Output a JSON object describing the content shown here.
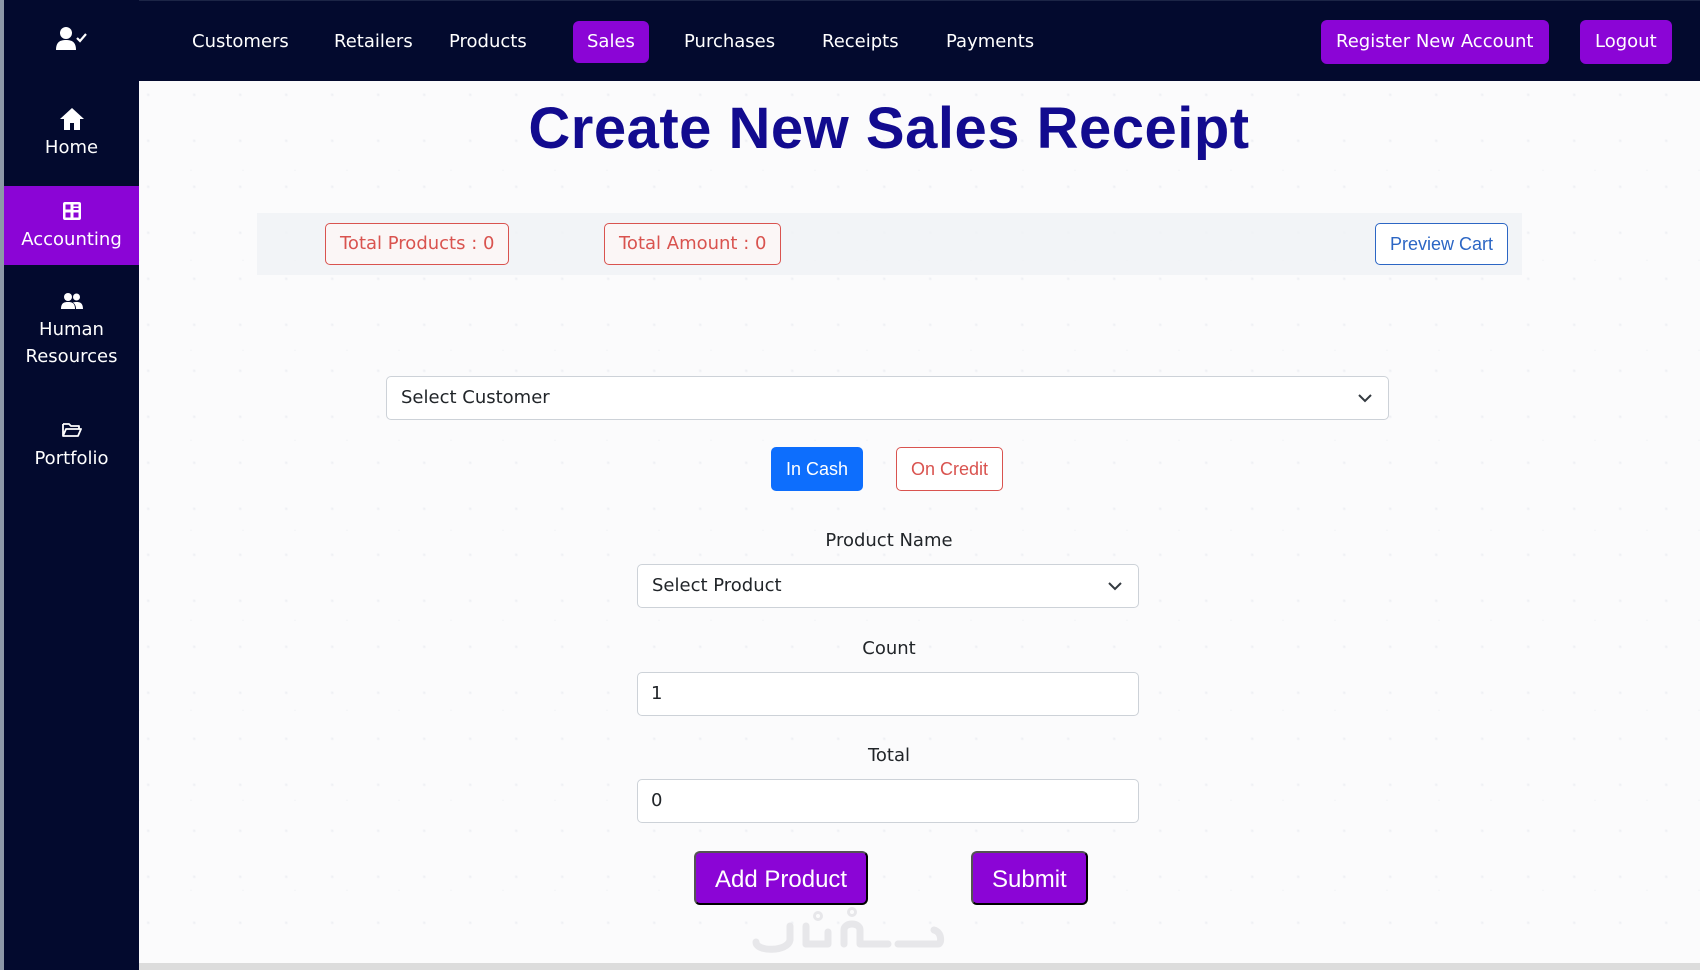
{
  "nav": {
    "items": [
      {
        "label": "Customers"
      },
      {
        "label": "Retailers"
      },
      {
        "label": "Products"
      },
      {
        "label": "Sales"
      },
      {
        "label": "Purchases"
      },
      {
        "label": "Receipts"
      },
      {
        "label": "Payments"
      }
    ],
    "active": "Sales",
    "register_label": "Register New Account",
    "logout_label": "Logout"
  },
  "sidebar": {
    "items": [
      {
        "label": "Home",
        "icon": "home-icon"
      },
      {
        "label": "Accounting",
        "icon": "accounting-icon"
      },
      {
        "label": "Human Resources",
        "icon": "users-icon"
      },
      {
        "label": "Portfolio",
        "icon": "folder-icon"
      }
    ],
    "active": "Accounting"
  },
  "page": {
    "title": "Create New Sales Receipt"
  },
  "cart": {
    "total_products": "Total Products : 0",
    "total_amount": "Total Amount : 0",
    "preview_label": "Preview Cart"
  },
  "form": {
    "customer_select": "Select Customer",
    "payment": {
      "cash": "In Cash",
      "credit": "On Credit",
      "selected": "In Cash"
    },
    "product_label": "Product Name",
    "product_select": "Select Product",
    "count_label": "Count",
    "count_value": "1",
    "total_label": "Total",
    "total_value": "0",
    "add_label": "Add Product",
    "submit_label": "Submit"
  },
  "colors": {
    "nav_bg": "#030a2e",
    "accent": "#8b05d6",
    "title": "#120b8f",
    "primary": "#0d6efd",
    "danger": "#d9534f"
  }
}
